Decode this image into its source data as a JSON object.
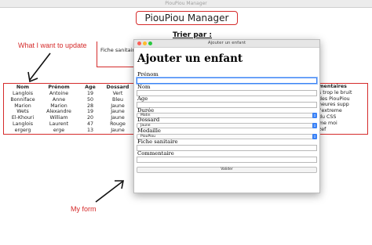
{
  "app": {
    "window_title": "PiouPiou Manager",
    "title": "PiouPiou Manager",
    "sort_label": "Trier par :",
    "sort_value": "Fiche sanitaire"
  },
  "annotations": {
    "update_note": "What I want to update",
    "form_note": "My form",
    "color": "#d52b2b"
  },
  "table": {
    "headers": {
      "nom": "Nom",
      "prenom": "Prénom",
      "age": "Age",
      "dossard": "Dossard"
    },
    "rows": [
      {
        "nom": "Langlois",
        "prenom": "Antoine",
        "age": "19",
        "dossard": "Vert"
      },
      {
        "nom": "Bonniface",
        "prenom": "Anne",
        "age": "50",
        "dossard": "Bleu"
      },
      {
        "nom": "Marion",
        "prenom": "Marion",
        "age": "28",
        "dossard": "Jaune"
      },
      {
        "nom": "Wets",
        "prenom": "Alexandre",
        "age": "19",
        "dossard": "Jaune"
      },
      {
        "nom": "El-Khouri",
        "prenom": "William",
        "age": "20",
        "dossard": "Jaune"
      },
      {
        "nom": "Langlois",
        "prenom": "Laurent",
        "age": "47",
        "dossard": "Rouge"
      },
      {
        "nom": "ergerg",
        "prenom": "erge",
        "age": "13",
        "dossard": "Jaune"
      }
    ],
    "comment_header": "mentaires",
    "comments": [
      "s trop le bruit",
      "des PiouPiou",
      "heures supp",
      "l'extreme",
      "du CSS",
      "me moi",
      "zef"
    ]
  },
  "modal": {
    "window_title": "Ajouter un enfant",
    "heading": "Ajouter un enfant",
    "fields": {
      "prenom_label": "Prénom",
      "nom_label": "Nom",
      "age_label": "Age",
      "duree_label": "Durée",
      "duree_value": "Matin",
      "dossard_label": "Dossard",
      "dossard_value": "Jaune",
      "medaille_label": "Medaille",
      "medaille_value": "PiouPiou",
      "fiche_label": "Fiche sanitaire",
      "commentaire_label": "Commentaire"
    },
    "submit_label": "Valider",
    "traffic_lights": {
      "close": "#fc5f57",
      "minimize": "#fdbc2e",
      "zoom": "#28c840"
    },
    "select_arrow_icon": "chevron-updown-icon"
  }
}
